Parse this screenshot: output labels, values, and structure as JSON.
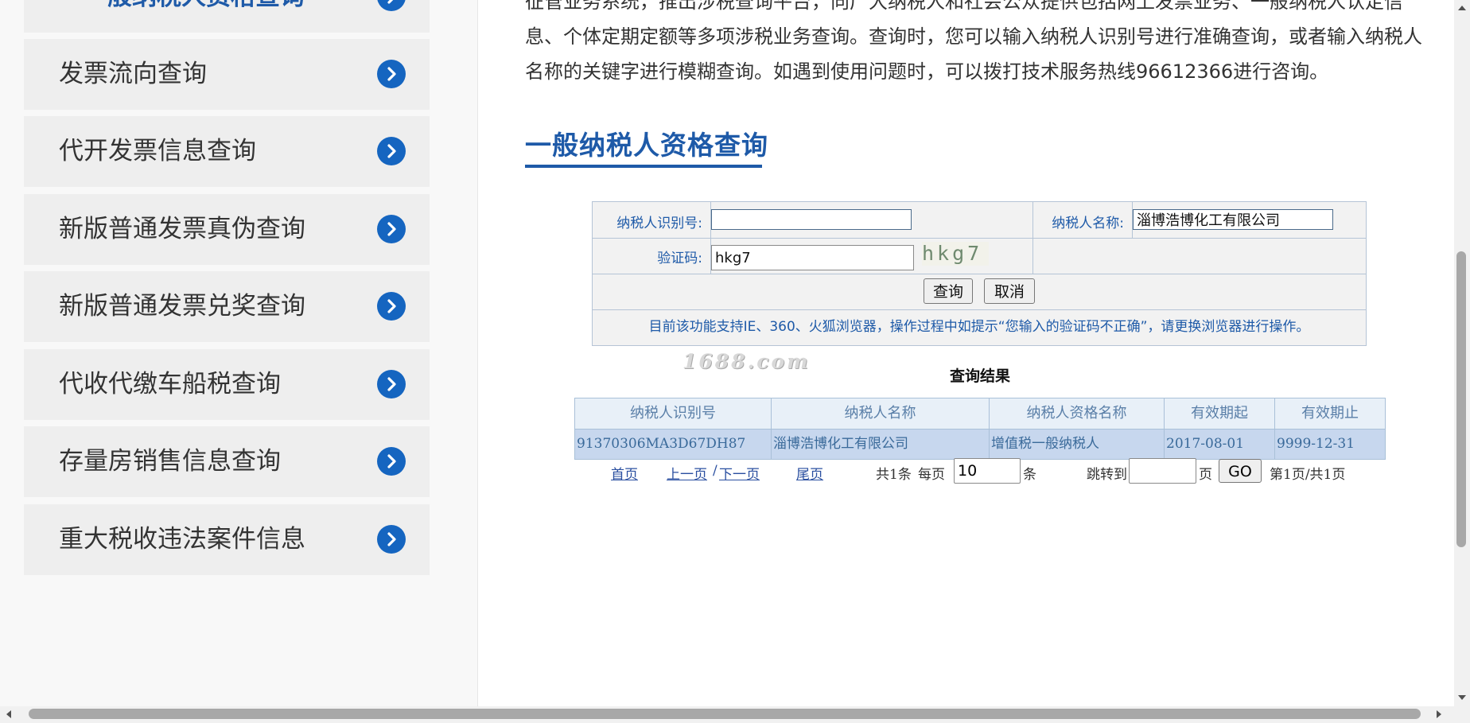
{
  "sidebar": {
    "items": [
      {
        "label": "一般纳税人资格查询",
        "active": true
      },
      {
        "label": "发票流向查询"
      },
      {
        "label": "代开发票信息查询"
      },
      {
        "label": "新版普通发票真伪查询"
      },
      {
        "label": "新版普通发票兑奖查询"
      },
      {
        "label": "代收代缴车船税查询"
      },
      {
        "label": "存量房销售信息查询"
      },
      {
        "label": "重大税收违法案件信息"
      }
    ]
  },
  "intro": {
    "line1": "征管业务系统，推出涉税查询平台，向广大纳税人和社会公众提供包括网上发票业务、一般纳税人认定信",
    "line2": "息、个体定期定额等多项涉税业务查询。查询时，您可以输入纳税人识别号进行准确查询，或者输入纳税人",
    "line3": "名称的关键字进行模糊查询。如遇到使用问题时，可以拨打技术服务热线96612366进行咨询。"
  },
  "section_title": "一般纳税人资格查询",
  "form": {
    "taxpayer_id_label": "纳税人识别号:",
    "taxpayer_id_value": "",
    "taxpayer_name_label": "纳税人名称:",
    "taxpayer_name_value": "淄博浩博化工有限公司",
    "captcha_label": "验证码:",
    "captcha_value": "hkg7",
    "captcha_image_text": "hkg7",
    "query_button": "查询",
    "cancel_button": "取消",
    "notice": "目前该功能支持IE、360、火狐浏览器，操作过程中如提示“您输入的验证码不正确”，请更换浏览器进行操作。"
  },
  "watermark": "1688.com",
  "results": {
    "title": "查询结果",
    "columns": [
      "纳税人识别号",
      "纳税人名称",
      "纳税人资格名称",
      "有效期起",
      "有效期止"
    ],
    "rows": [
      [
        "91370306MA3D67DH87",
        "淄博浩博化工有限公司",
        "增值税一般纳税人",
        "2017-08-01",
        "9999-12-31"
      ]
    ]
  },
  "pager": {
    "first": "首页",
    "prev": "上一页",
    "slash": "/",
    "next": "下一页",
    "last": "尾页",
    "total": "共1条",
    "per_page_label": "每页",
    "per_page_value": "10",
    "per_page_unit": "条",
    "jump_label": "跳转到",
    "jump_value": "",
    "page_unit": "页",
    "go_button": "GO",
    "status": "第1页/共1页"
  },
  "colors": {
    "accent": "#1e5aa8",
    "chevron": "#1565c0",
    "row_highlight": "#c7d7ee"
  }
}
